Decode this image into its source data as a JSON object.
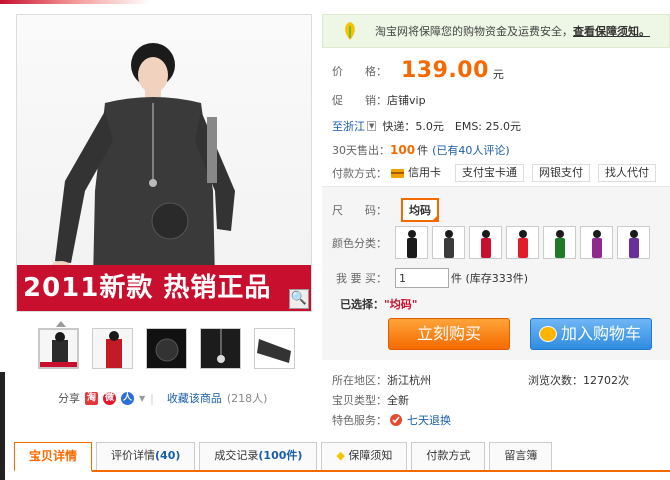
{
  "gallery": {
    "banner_text": "2011新款 热销正品",
    "thumbs": [
      {
        "name": "model-black-dress",
        "color": "#2b2b2b"
      },
      {
        "name": "model-red-top",
        "color": "#c21b26"
      },
      {
        "name": "black-rose-detail",
        "color": "#111111"
      },
      {
        "name": "necklace-detail",
        "color": "#1c1c1c"
      },
      {
        "name": "sleeve-detail",
        "color": "#333333"
      }
    ]
  },
  "share": {
    "label": "分享",
    "favorite_label": "收藏该商品",
    "favorite_count": "(218人)"
  },
  "notice": {
    "text": "淘宝网将保障您的购物资金及运费安全，",
    "link": "查看保障须知。"
  },
  "product": {
    "price_label": "价　　格：",
    "price": "139.00",
    "price_unit": "元",
    "promo_label": "促　　销：",
    "promo_value": "店铺vip",
    "ship_to": "至浙江",
    "shipping": "快递：5.0元　EMS: 25.0元",
    "sold_label": "30天售出：",
    "sold_count": "100",
    "sold_unit": "件",
    "reviews": "(已有40人评论)",
    "payment_label": "付款方式：",
    "payment_methods": [
      "信用卡",
      "支付宝卡通",
      "网银支付",
      "找人代付"
    ]
  },
  "selection": {
    "size_label": "尺　　码：",
    "size_option": "均码",
    "color_label": "颜色分类：",
    "swatches": [
      {
        "name": "black",
        "color": "#1a1a1a"
      },
      {
        "name": "dark-gray",
        "color": "#3b3b3b"
      },
      {
        "name": "red",
        "color": "#c8102e"
      },
      {
        "name": "bright-red",
        "color": "#e01e2b"
      },
      {
        "name": "green",
        "color": "#1f7a2a"
      },
      {
        "name": "purple",
        "color": "#8e2a8e"
      },
      {
        "name": "violet",
        "color": "#6a2f9a"
      }
    ],
    "qty_label": "我 要 买：",
    "qty_value": "1",
    "qty_unit": "件 (库存333件)",
    "selected_label": "已选择：",
    "selected_value": "\"均码\"",
    "buy_now": "立刻购买",
    "add_to_cart": "加入购物车"
  },
  "meta": {
    "location_label": "所在地区：",
    "location_value": "浙江杭州",
    "views": "浏览次数：12702次",
    "type_label": "宝贝类型：",
    "type_value": "全新",
    "service_label": "特色服务：",
    "service_value": "七天退换"
  },
  "tabs": [
    {
      "label": "宝贝详情"
    },
    {
      "label": "评价详情",
      "num": "(40)"
    },
    {
      "label": "成交记录",
      "num": "(100件)"
    },
    {
      "label": "保障须知"
    },
    {
      "label": "付款方式"
    },
    {
      "label": "留言簿"
    }
  ],
  "colors": {
    "accent": "#f56a00",
    "link": "#1a5ea8",
    "banner": "#c8102e"
  }
}
